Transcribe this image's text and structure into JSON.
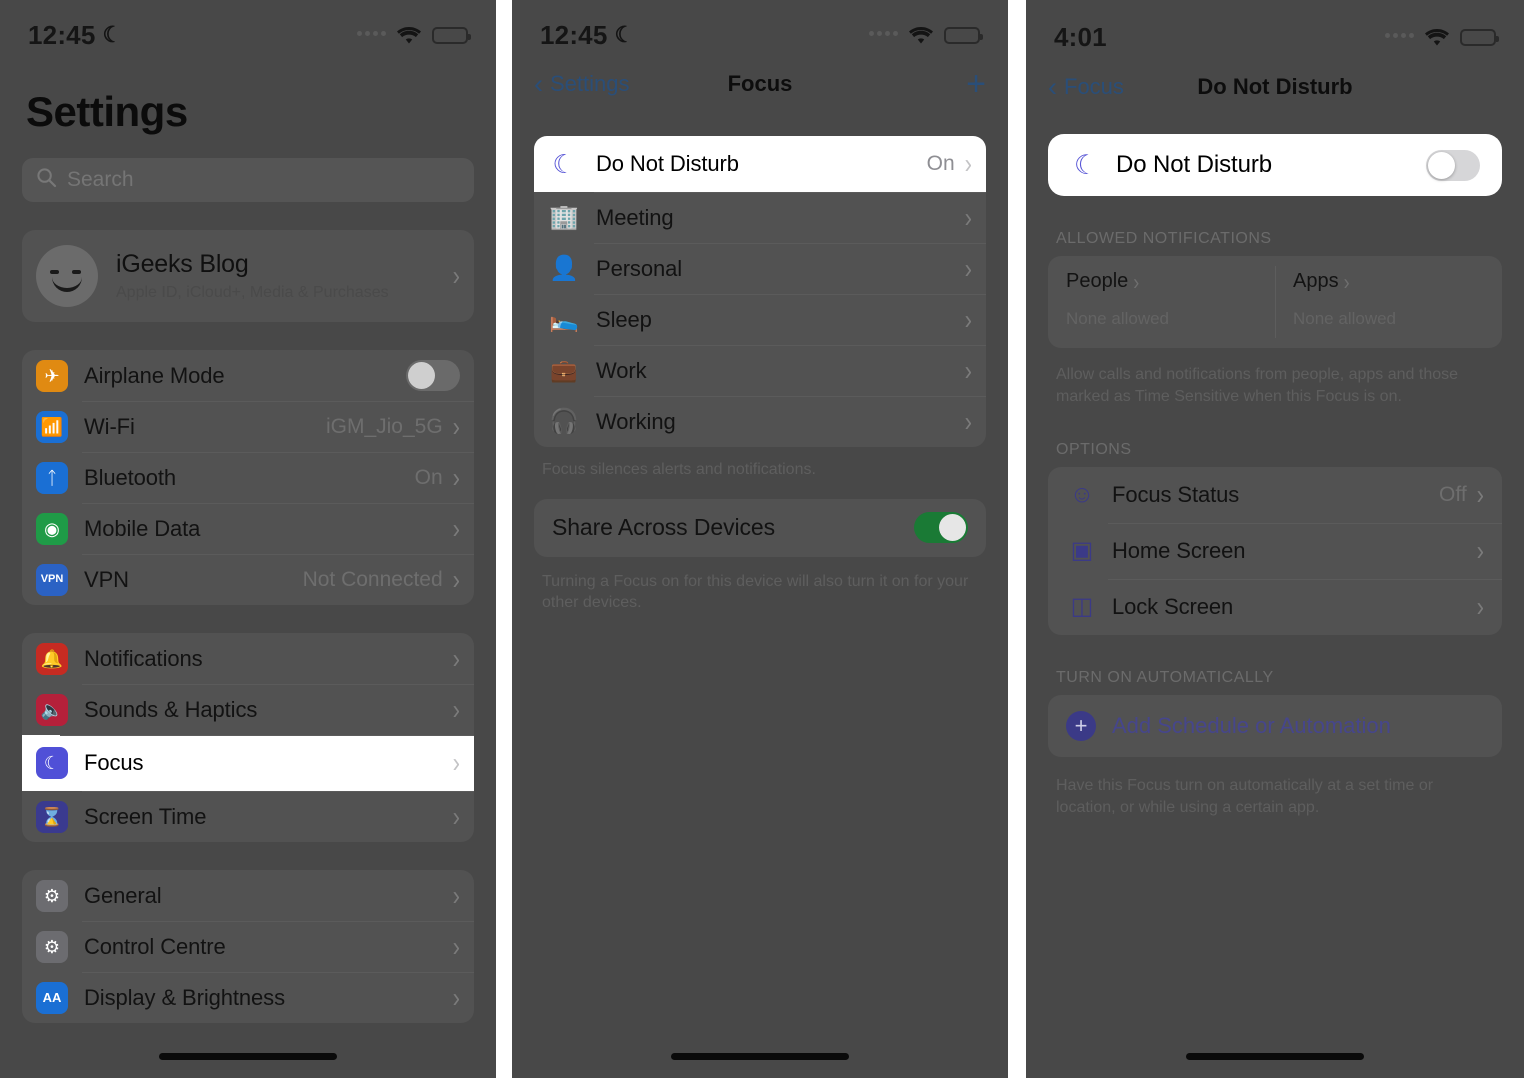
{
  "panels": [
    {
      "name": "settings-root",
      "status_bar": {
        "time": "12:45",
        "moon_icon": "crescent-moon-icon",
        "wifi_icon": "wifi-icon",
        "battery_level": "medium"
      },
      "title": "Settings",
      "search": {
        "placeholder": "Search",
        "icon": "search-icon"
      },
      "account": {
        "name": "iGeeks Blog",
        "subtitle": "Apple ID, iCloud+, Media & Purchases",
        "avatar": "memoji-avatar"
      },
      "groups": [
        {
          "rows": [
            {
              "label": "Airplane Mode",
              "icon": "airplane-icon",
              "icon_color": "#e08a12",
              "control": "toggle",
              "toggle_on": false
            },
            {
              "label": "Wi-Fi",
              "icon": "wifi-icon",
              "icon_color": "#1a6fd4",
              "value": "iGM_Jio_5G",
              "control": "chevron"
            },
            {
              "label": "Bluetooth",
              "icon": "bluetooth-icon",
              "icon_color": "#1a6fd4",
              "value": "On",
              "control": "chevron"
            },
            {
              "label": "Mobile Data",
              "icon": "cellular-icon",
              "icon_color": "#1f9b47",
              "value": "",
              "control": "chevron"
            },
            {
              "label": "VPN",
              "icon": "vpn-icon",
              "icon_color": "#2b62c4",
              "value": "Not Connected",
              "control": "chevron"
            }
          ]
        },
        {
          "rows": [
            {
              "label": "Notifications",
              "icon": "bell-icon",
              "icon_color": "#c62b22",
              "value": "",
              "control": "chevron"
            },
            {
              "label": "Sounds & Haptics",
              "icon": "speaker-icon",
              "icon_color": "#b5203a",
              "value": "",
              "control": "chevron"
            },
            {
              "label": "Focus",
              "icon": "crescent-moon-icon",
              "icon_color": "#5050d7",
              "value": "",
              "control": "chevron",
              "highlighted": true
            },
            {
              "label": "Screen Time",
              "icon": "hourglass-icon",
              "icon_color": "#3a3a8f",
              "value": "",
              "control": "chevron"
            }
          ]
        },
        {
          "rows": [
            {
              "label": "General",
              "icon": "gear-icon",
              "icon_color": "#6c6c70",
              "value": "",
              "control": "chevron"
            },
            {
              "label": "Control Centre",
              "icon": "control-centre-icon",
              "icon_color": "#6c6c70",
              "value": "",
              "control": "chevron"
            },
            {
              "label": "Display & Brightness",
              "icon": "display-brightness-icon",
              "icon_color": "#1a6fd4",
              "value": "",
              "control": "chevron"
            }
          ]
        }
      ]
    },
    {
      "name": "focus-list",
      "status_bar": {
        "time": "12:45",
        "moon_icon": "crescent-moon-icon",
        "wifi_icon": "wifi-icon",
        "battery_level": "medium"
      },
      "nav": {
        "back_label": "Settings",
        "back_icon": "chevron-left-icon",
        "title": "Focus",
        "add_icon": "plus-icon"
      },
      "focus_rows": [
        {
          "label": "Do Not Disturb",
          "icon": "crescent-moon-icon",
          "icon_color": "#5856d6",
          "value": "On",
          "highlighted": true
        },
        {
          "label": "Meeting",
          "icon": "building-icon",
          "icon_color": "#1f8a45",
          "value": ""
        },
        {
          "label": "Personal",
          "icon": "person-icon",
          "icon_color": "#8e3ca0",
          "value": ""
        },
        {
          "label": "Sleep",
          "icon": "bed-icon",
          "icon_color": "#178a86",
          "value": ""
        },
        {
          "label": "Work",
          "icon": "briefcase-icon",
          "icon_color": "#17777f",
          "value": ""
        },
        {
          "label": "Working",
          "icon": "headphones-icon",
          "icon_color": "#b02035",
          "value": ""
        }
      ],
      "focus_footnote": "Focus silences alerts and notifications.",
      "share": {
        "label": "Share Across Devices",
        "toggle_on": true,
        "footnote": "Turning a Focus on for this device will also turn it on for your other devices."
      }
    },
    {
      "name": "do-not-disturb-detail",
      "status_bar": {
        "time": "4:01",
        "wifi_icon": "wifi-icon",
        "battery_level": "full"
      },
      "nav": {
        "back_label": "Focus",
        "back_icon": "chevron-left-icon",
        "title": "Do Not Disturb"
      },
      "main_toggle": {
        "label": "Do Not Disturb",
        "icon": "crescent-moon-icon",
        "icon_color": "#5856d6",
        "toggle_on": false,
        "highlighted": true
      },
      "allowed": {
        "section_title": "ALLOWED NOTIFICATIONS",
        "columns": [
          {
            "title": "People",
            "subtitle": "None allowed",
            "chevron": "chevron-right-icon"
          },
          {
            "title": "Apps",
            "subtitle": "None allowed",
            "chevron": "chevron-right-icon"
          }
        ],
        "footnote": "Allow calls and notifications from people, apps and those marked as Time Sensitive when this Focus is on."
      },
      "options": {
        "section_title": "OPTIONS",
        "rows": [
          {
            "label": "Focus Status",
            "icon": "focus-status-icon",
            "value": "Off"
          },
          {
            "label": "Home Screen",
            "icon": "home-screen-icon",
            "value": ""
          },
          {
            "label": "Lock Screen",
            "icon": "lock-screen-icon",
            "value": ""
          }
        ]
      },
      "automation": {
        "section_title": "TURN ON AUTOMATICALLY",
        "add_label": "Add Schedule or Automation",
        "add_icon": "plus-circle-icon",
        "footnote": "Have this Focus turn on automatically at a set time or location, or while using a certain app."
      }
    }
  ]
}
